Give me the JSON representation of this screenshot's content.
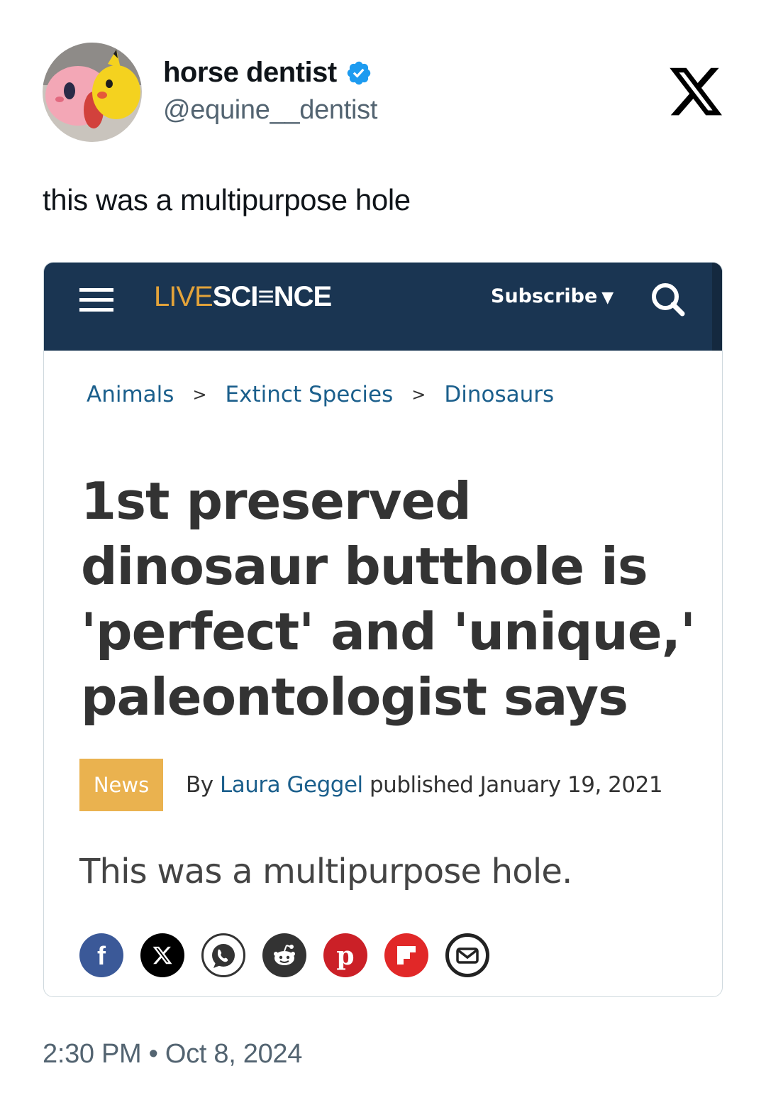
{
  "tweet": {
    "display_name": "horse dentist",
    "handle": "@equine__dentist",
    "text": "this was a multipurpose hole",
    "timestamp": "2:30 PM • Oct 8, 2024",
    "verified": true
  },
  "embed": {
    "nav": {
      "logo_part1": "LIVE",
      "logo_part2": "SCI≡NCE",
      "subscribe_label": "Subscribe",
      "subscribe_caret": "▼"
    },
    "breadcrumb": [
      {
        "label": "Animals"
      },
      {
        "label": "Extinct Species"
      },
      {
        "label": "Dinosaurs"
      }
    ],
    "breadcrumb_sep": ">",
    "headline": "1st preserved dinosaur butthole is 'perfect' and 'unique,' paleontologist says",
    "category_badge": "News",
    "byline_prefix": "By",
    "author": "Laura Geggel",
    "published_text": "published January 19, 2021",
    "standfirst": "This was a multipurpose hole.",
    "share_buttons": [
      {
        "icon": "facebook-icon",
        "color": "#3b5998"
      },
      {
        "icon": "x-icon",
        "color": "#000000"
      },
      {
        "icon": "whatsapp-icon",
        "color": "#ffffff"
      },
      {
        "icon": "reddit-icon",
        "color": "#333333"
      },
      {
        "icon": "pinterest-icon",
        "color": "#cb2027"
      },
      {
        "icon": "flipboard-icon",
        "color": "#e12828"
      },
      {
        "icon": "email-icon",
        "color": "#ffffff"
      }
    ]
  },
  "colors": {
    "nav_bg": "#1a3552",
    "logo_accent": "#e3a33a",
    "link": "#1b5f8c",
    "badge": "#eab24f",
    "verified": "#1d9bf0",
    "muted": "#536471"
  }
}
